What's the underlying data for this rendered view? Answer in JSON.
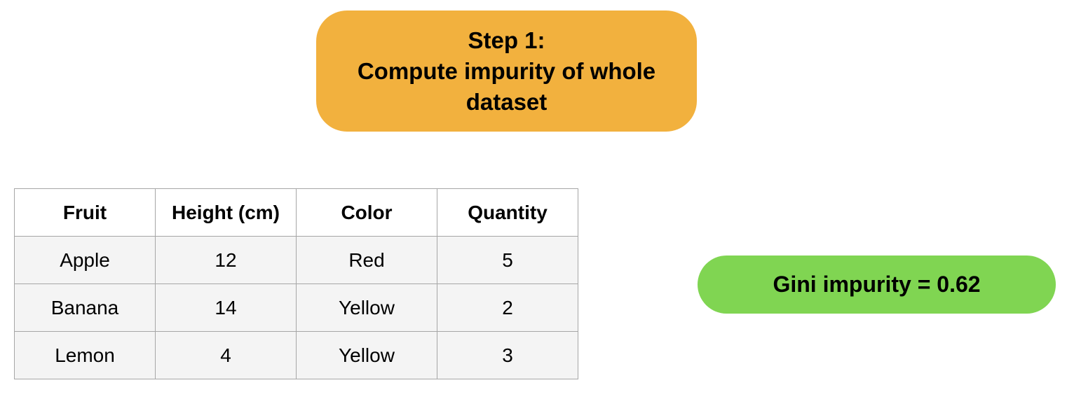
{
  "step": {
    "title": "Step 1:",
    "description": "Compute impurity of whole dataset"
  },
  "table": {
    "headers": [
      "Fruit",
      "Height (cm)",
      "Color",
      "Quantity"
    ],
    "rows": [
      [
        "Apple",
        "12",
        "Red",
        "5"
      ],
      [
        "Banana",
        "14",
        "Yellow",
        "2"
      ],
      [
        "Lemon",
        "4",
        "Yellow",
        "3"
      ]
    ]
  },
  "result": {
    "label": "Gini impurity = 0.62"
  },
  "colors": {
    "step_box": "#f2b13e",
    "result_pill": "#80d552",
    "table_row_bg": "#f4f4f4",
    "table_border": "#a6a6a6"
  }
}
